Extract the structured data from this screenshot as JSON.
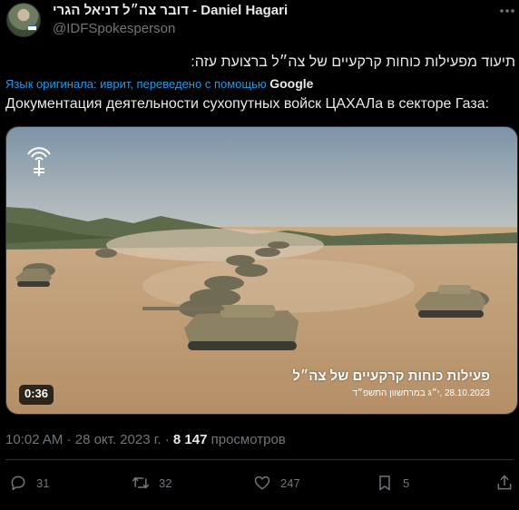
{
  "author": {
    "display_name": "דובר צה״ל דניאל הגרי - Daniel Hagari",
    "handle": "@IDFSpokesperson"
  },
  "tweet": {
    "text_original": "תיעוד מפעילות כוחות קרקעיים של צה״ל ברצועת עזה:",
    "translation_note": "Язык оригинала: иврит, переведено с помощью",
    "translation_provider": "Google",
    "text_translated": "Документация деятельности сухопутных войск ЦАХАЛа в секторе Газа:"
  },
  "media": {
    "duration": "0:36",
    "caption": "פעילות כוחות קרקעיים של צה״ל",
    "caption_date": "28.10.2023 ,י״ג במרחשוון התשפ״ד"
  },
  "meta": {
    "time": "10:02 AM",
    "separator": "·",
    "date": "28 окт. 2023 г.",
    "views_count": "8 147",
    "views_label": "просмотров"
  },
  "actions": {
    "replies": "31",
    "reposts": "32",
    "likes": "247",
    "bookmarks": "5"
  },
  "icons": [
    "more-icon",
    "reply-icon",
    "repost-icon",
    "like-icon",
    "bookmark-icon",
    "share-icon",
    "idf-logo-icon"
  ],
  "colors": {
    "background": "#000000",
    "text": "#e7e9ea",
    "muted": "#71767b",
    "link": "#1d9bf0",
    "divider": "#2f3336"
  }
}
